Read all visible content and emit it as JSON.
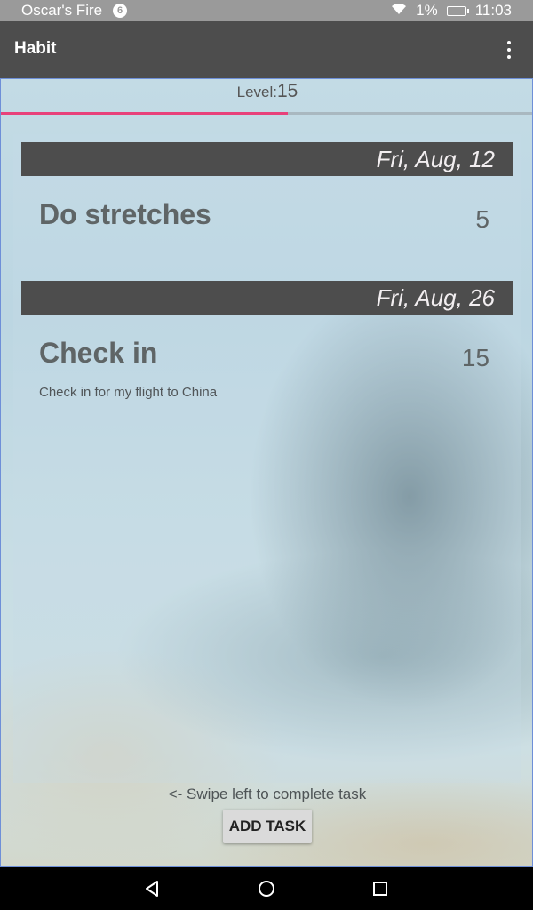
{
  "status_bar": {
    "carrier": "Oscar's Fire",
    "notification_badge": "6",
    "battery_percent": "1%",
    "time": "11:03",
    "icons": [
      "wifi-icon",
      "battery-charging-icon"
    ]
  },
  "app_bar": {
    "title": "Habit",
    "menu_icon": "overflow-menu-icon"
  },
  "level": {
    "label": "Level:",
    "value": "15",
    "progress": 0.54
  },
  "sections": [
    {
      "date": "Fri, Aug, 12",
      "task": {
        "title": "Do stretches",
        "points": "5",
        "description": ""
      }
    },
    {
      "date": "Fri, Aug, 26",
      "task": {
        "title": "Check in",
        "points": "15",
        "description": "Check in for my flight to China"
      }
    }
  ],
  "footer": {
    "hint": "<- Swipe left to complete task",
    "add_task_label": "ADD TASK"
  },
  "nav_bar": {
    "icons": [
      "back-icon",
      "home-icon",
      "recents-icon"
    ]
  },
  "colors": {
    "accent": "#e8417a",
    "app_bar": "#4d4d4d",
    "date_header": "#4d4d4d"
  }
}
